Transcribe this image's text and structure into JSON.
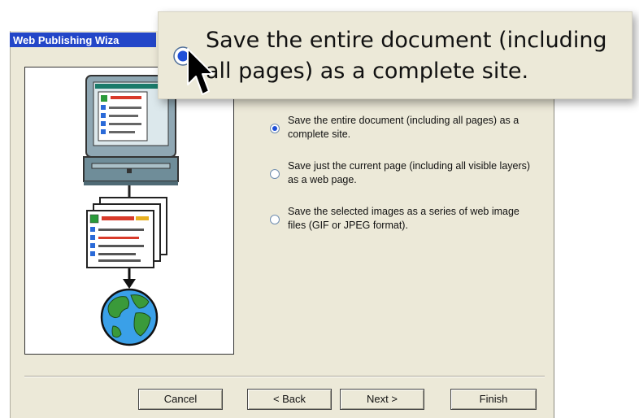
{
  "window": {
    "title": "Web Publishing Wiza"
  },
  "callout": {
    "text": "Save the entire document (including all pages) as a complete site."
  },
  "options": [
    {
      "label": "Save the entire document (including all pages) as a complete site.",
      "selected": true
    },
    {
      "label": "Save just the current page (including all visible layers) as a web page.",
      "selected": false
    },
    {
      "label": "Save the selected images as a series of web image files (GIF or JPEG format).",
      "selected": false
    }
  ],
  "buttons": {
    "cancel": "Cancel",
    "back": "< Back",
    "next": "Next >",
    "finish": "Finish"
  },
  "colors": {
    "accent": "#1e4fd8",
    "titlebar": "#2346c8",
    "dialog_bg": "#ece9d8"
  },
  "icons": [
    "computer-monitor-icon",
    "web-document-icon",
    "down-arrow-icon",
    "globe-icon",
    "arrow-cursor-icon"
  ]
}
